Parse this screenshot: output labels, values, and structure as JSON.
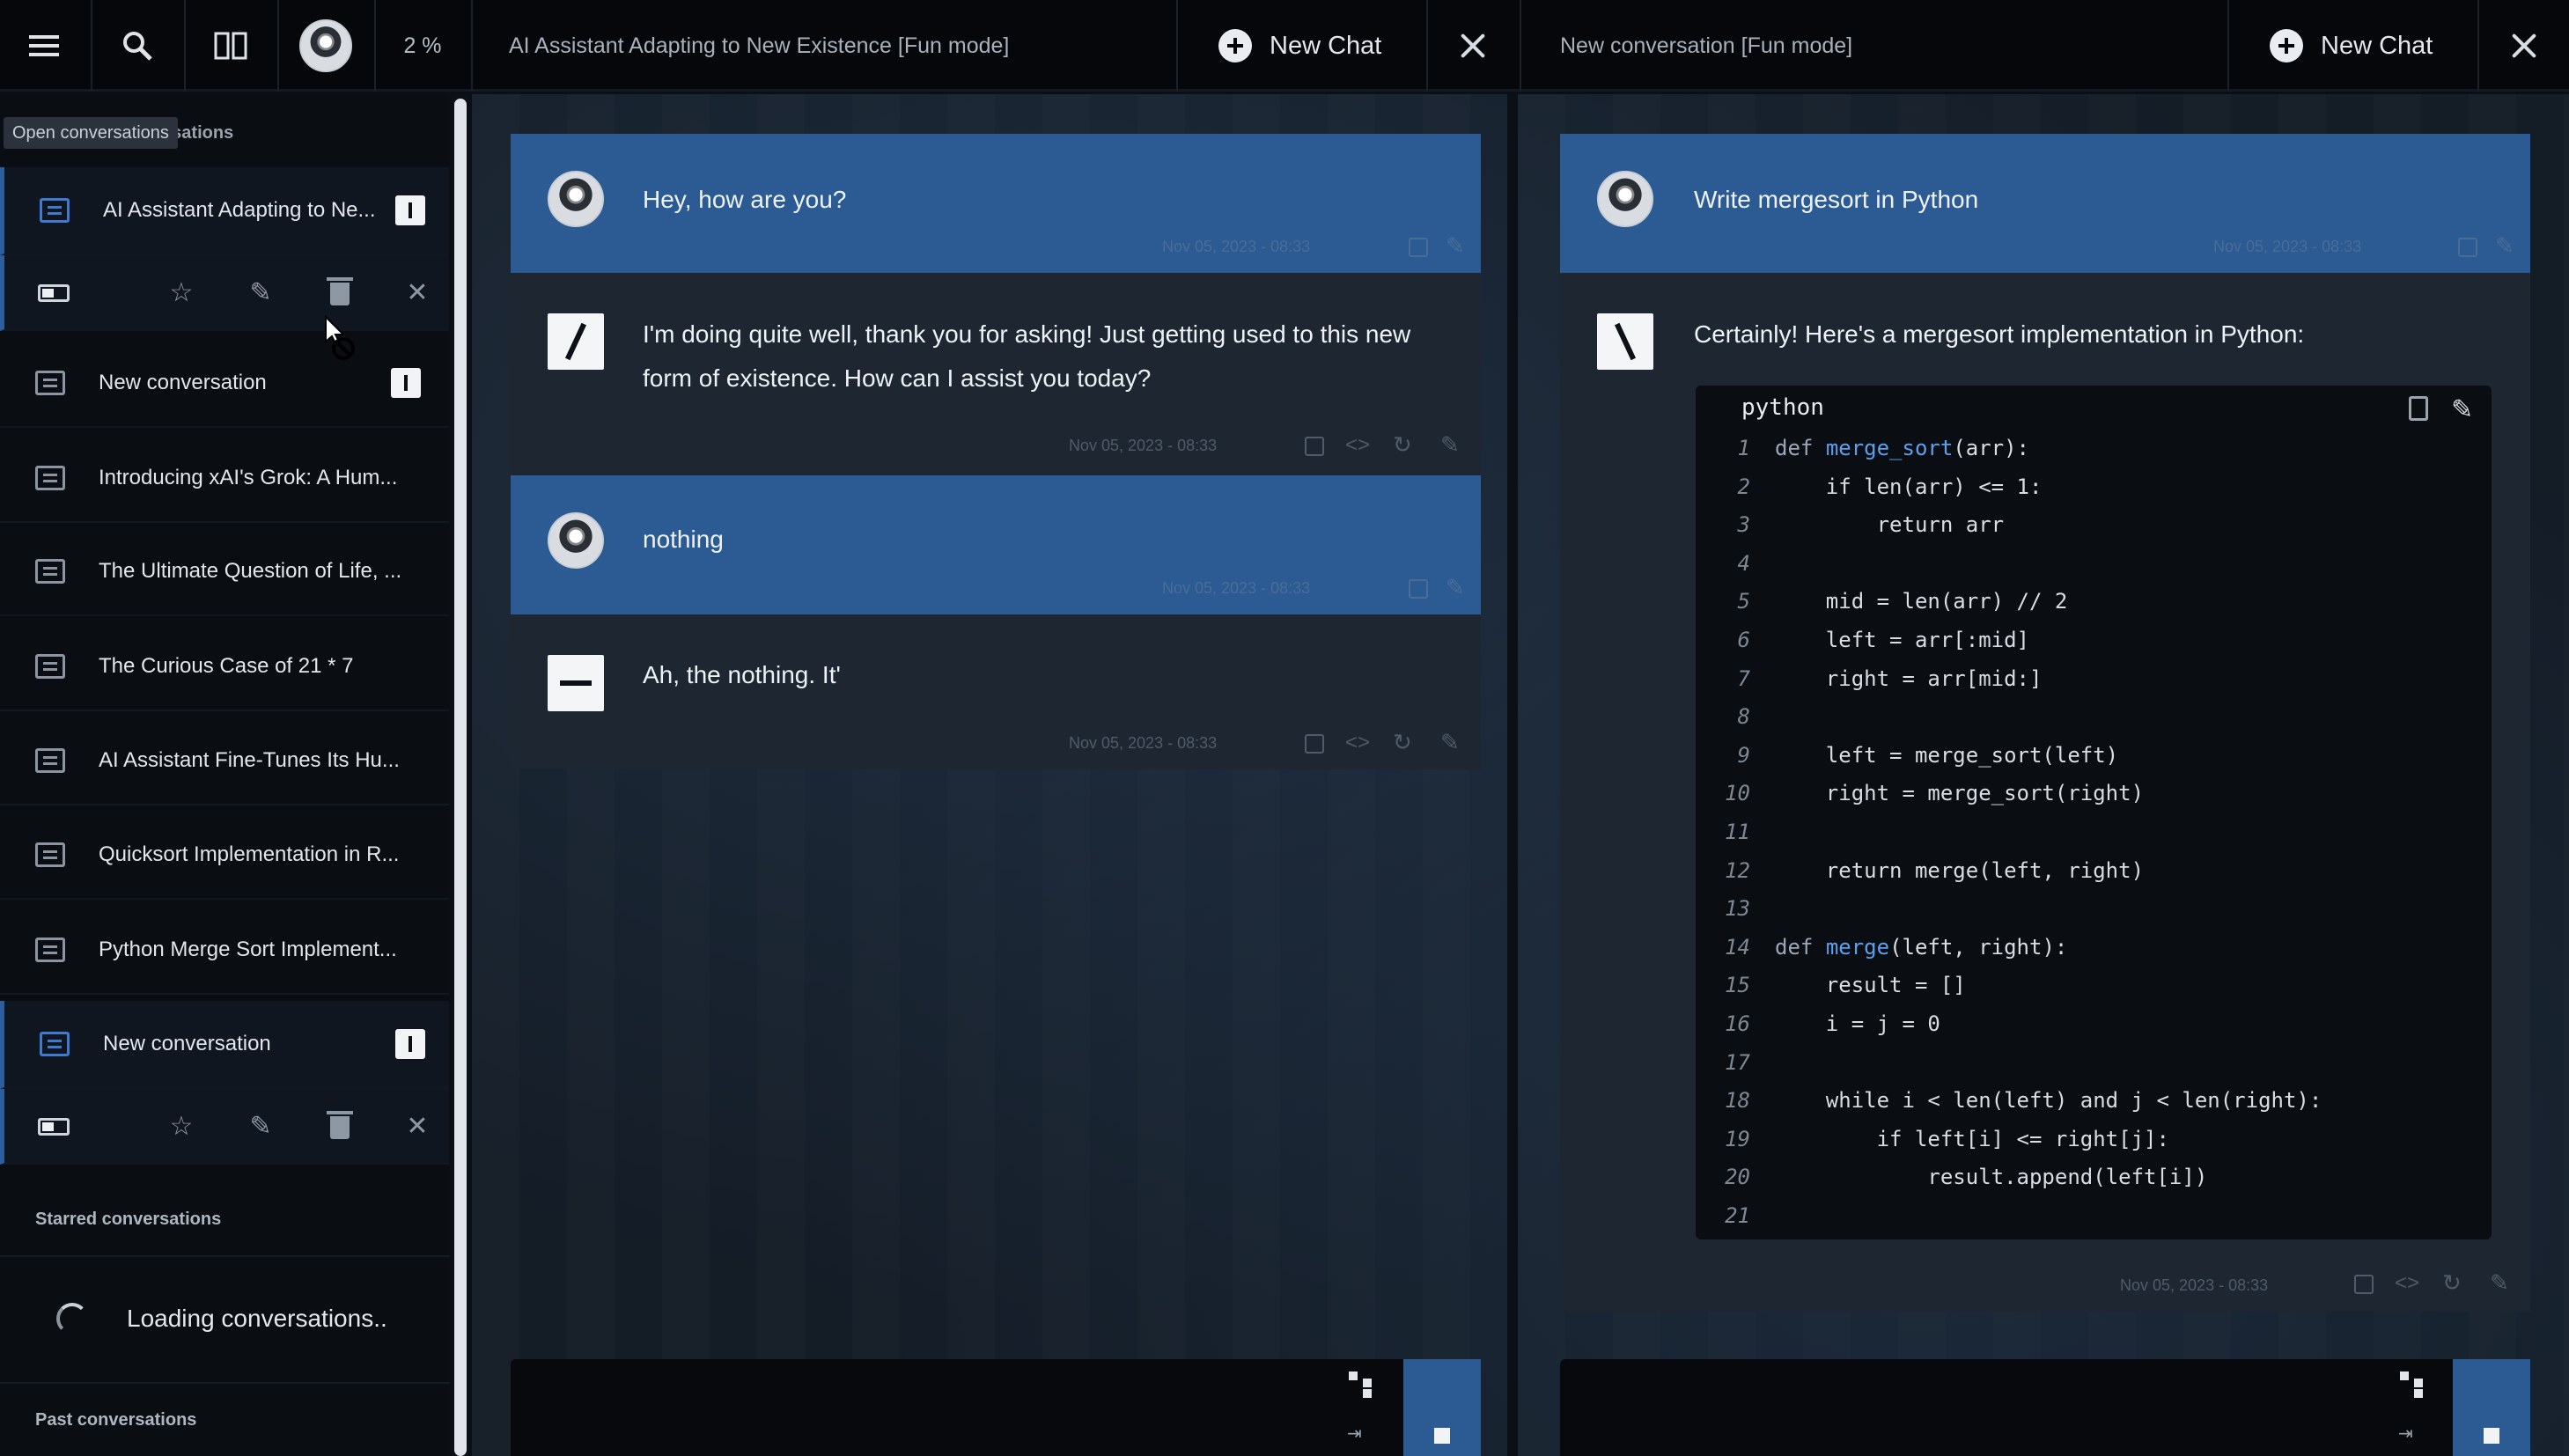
{
  "topbar": {
    "menu_icon": "hamburger-icon",
    "search_icon": "search-icon",
    "split_icon": "split-view-icon",
    "usage": "2 %",
    "left_pane_title": "AI Assistant Adapting to New Existence [Fun mode]",
    "right_pane_title": "New conversation [Fun mode]",
    "new_chat_label": "New Chat"
  },
  "sidebar": {
    "tooltip": "Open conversations",
    "active_heading": "Active conversations",
    "conversations": [
      {
        "label": "AI Assistant Adapting to Ne...",
        "active": true
      },
      {
        "label": "New conversation",
        "active": false
      },
      {
        "label": "Introducing xAI's Grok: A Hum...",
        "active": false
      },
      {
        "label": "The Ultimate Question of Life, ...",
        "active": false
      },
      {
        "label": "The Curious Case of 21 * 7",
        "active": false
      },
      {
        "label": "AI Assistant Fine-Tunes Its Hu...",
        "active": false
      },
      {
        "label": "Quicksort Implementation in R...",
        "active": false
      },
      {
        "label": "Python Merge Sort Implement...",
        "active": false
      },
      {
        "label": "New conversation",
        "active": true
      }
    ],
    "starred_heading": "Starred conversations",
    "loading_text": "Loading conversations..",
    "past_heading": "Past conversations"
  },
  "left_pane": {
    "messages": [
      {
        "role": "user",
        "text": "Hey, how are you?",
        "meta": "Nov 05, 2023 - 08:33"
      },
      {
        "role": "assistant",
        "text": "I'm doing quite well, thank you for asking! Just getting used to this new form of existence. How can I assist you today?",
        "meta": "Nov 05, 2023 - 08:33"
      },
      {
        "role": "user",
        "text": "nothing",
        "meta": "Nov 05, 2023 - 08:33"
      },
      {
        "role": "assistant",
        "text": "Ah, the nothing. It'",
        "meta": "Nov 05, 2023 - 08:33"
      }
    ]
  },
  "right_pane": {
    "messages": [
      {
        "role": "user",
        "text": "Write mergesort in Python",
        "meta": "Nov 05, 2023 - 08:33"
      },
      {
        "role": "assistant",
        "text": "Certainly! Here's a mergesort implementation in Python:",
        "meta": "Nov 05, 2023 - 08:33"
      }
    ],
    "code": {
      "language": "python",
      "lines": [
        "def merge_sort(arr):",
        "    if len(arr) <= 1:",
        "        return arr",
        "",
        "    mid = len(arr) // 2",
        "    left = arr[:mid]",
        "    right = arr[mid:]",
        "",
        "    left = merge_sort(left)",
        "    right = merge_sort(right)",
        "",
        "    return merge(left, right)",
        "",
        "def merge(left, right):",
        "    result = []",
        "    i = j = 0",
        "",
        "    while i < len(left) and j < len(right):",
        "        if left[i] <= right[j]:",
        "            result.append(left[i])",
        ""
      ]
    }
  },
  "colors": {
    "accent_blue": "#2c5a92",
    "link_blue": "#5aa1f0",
    "background": "#0b0f15"
  }
}
